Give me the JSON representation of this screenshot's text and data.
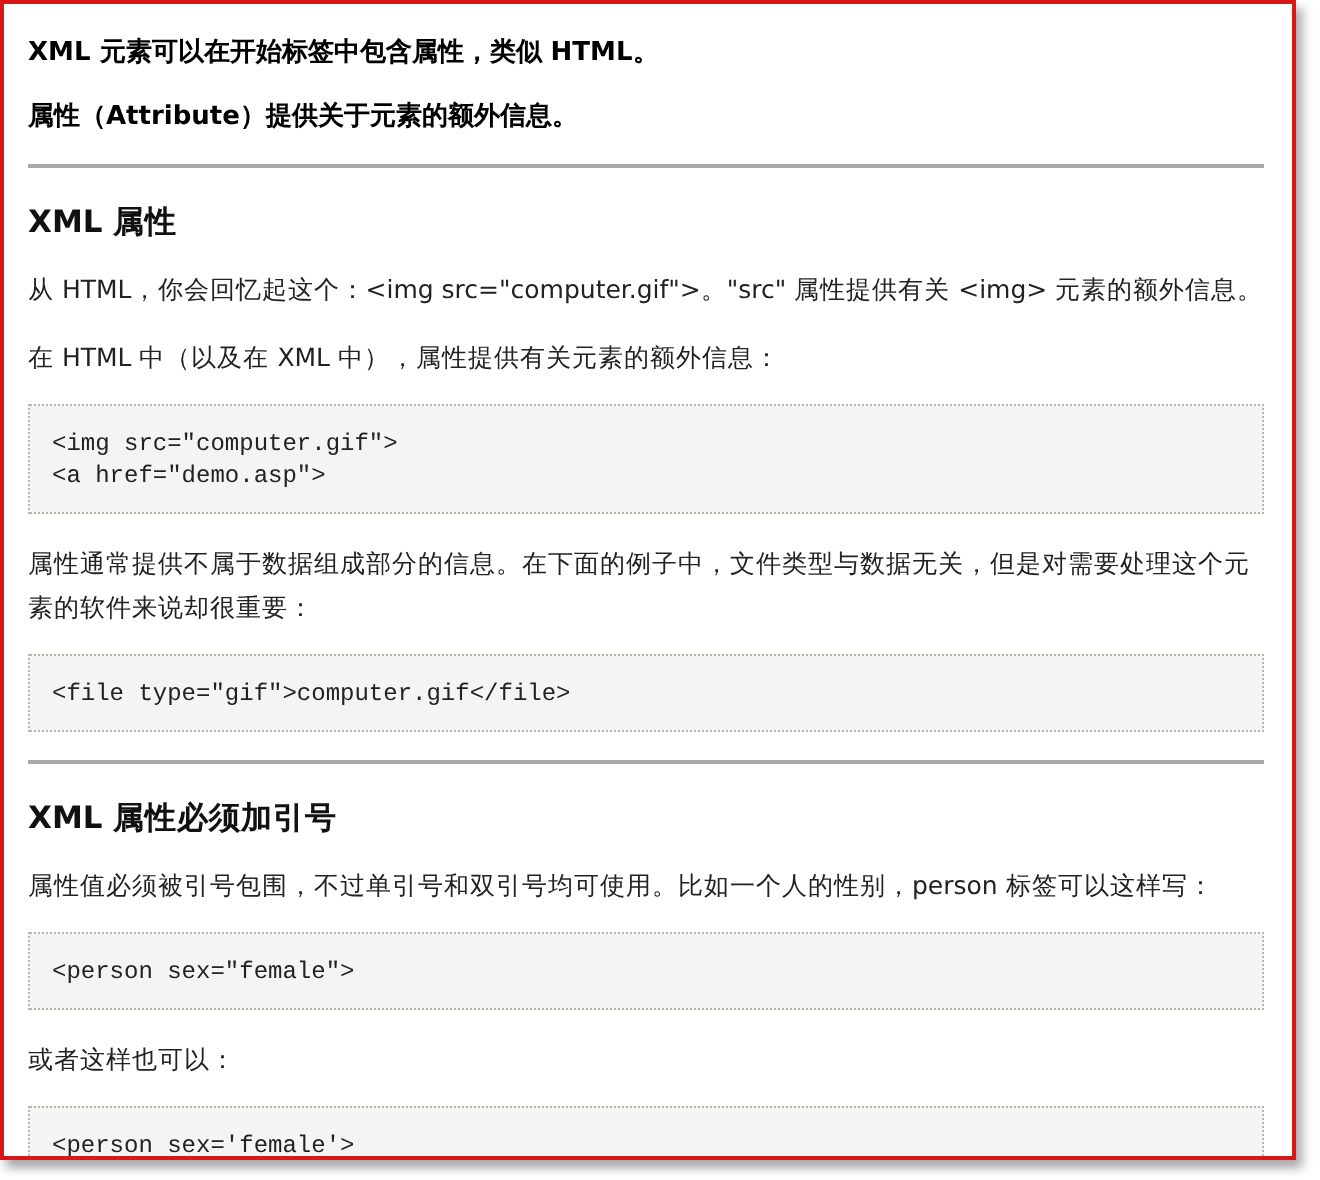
{
  "blocks": [
    {
      "kind": "lead",
      "text": "XML 元素可以在开始标签中包含属性，类似 HTML。"
    },
    {
      "kind": "lead",
      "text": "属性（Attribute）提供关于元素的额外信息。"
    },
    {
      "kind": "rule"
    },
    {
      "kind": "heading",
      "text": "XML 属性"
    },
    {
      "kind": "para",
      "text": "从 HTML，你会回忆起这个：<img src=\"computer.gif\">。\"src\" 属性提供有关 <img> 元素的额外信息。"
    },
    {
      "kind": "para",
      "text": "在 HTML 中（以及在 XML 中），属性提供有关元素的额外信息："
    },
    {
      "kind": "code",
      "lines": [
        "<img src=\"computer.gif\">",
        "<a href=\"demo.asp\">"
      ]
    },
    {
      "kind": "para",
      "text": "属性通常提供不属于数据组成部分的信息。在下面的例子中，文件类型与数据无关，但是对需要处理这个元素的软件来说却很重要："
    },
    {
      "kind": "code",
      "lines": [
        "<file type=\"gif\">computer.gif</file>"
      ]
    },
    {
      "kind": "rule"
    },
    {
      "kind": "heading",
      "text": "XML 属性必须加引号"
    },
    {
      "kind": "para",
      "text": "属性值必须被引号包围，不过单引号和双引号均可使用。比如一个人的性别，person 标签可以这样写："
    },
    {
      "kind": "code",
      "lines": [
        "<person sex=\"female\">"
      ]
    },
    {
      "kind": "para",
      "text": "或者这样也可以："
    },
    {
      "kind": "code",
      "lines": [
        "<person sex='female'>"
      ]
    }
  ]
}
